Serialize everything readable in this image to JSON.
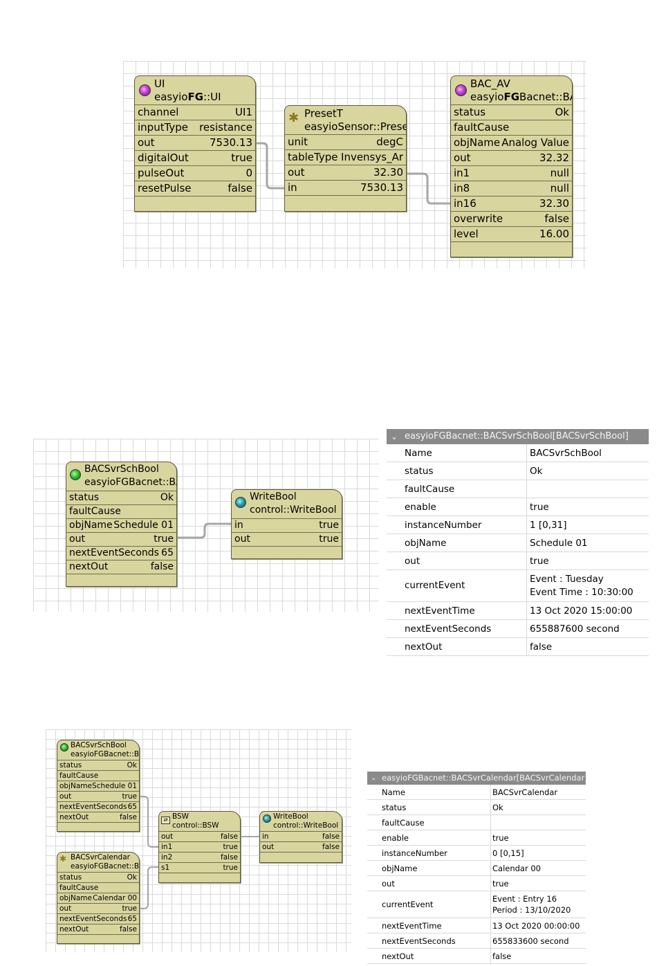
{
  "diagram1": {
    "ui": {
      "title": "UI",
      "type_prefix": "easyio",
      "type_bold": "FG",
      "type_suffix": "::UI",
      "rows": [
        {
          "k": "channel",
          "v": "UI1"
        },
        {
          "k": "inputType",
          "v": "resistance"
        },
        {
          "k": "out",
          "v": "7530.13"
        },
        {
          "k": "digitalOut",
          "v": "true"
        },
        {
          "k": "pulseOut",
          "v": "0"
        },
        {
          "k": "resetPulse",
          "v": "false"
        }
      ]
    },
    "preset": {
      "title": "PresetT",
      "type": "easyioSensor::Prese",
      "rows": [
        {
          "k": "unit",
          "v": "degC"
        },
        {
          "k": "tableType",
          "v": "Invensys_Ar"
        },
        {
          "k": "out",
          "v": "32.30"
        },
        {
          "k": "in",
          "v": "7530.13"
        }
      ]
    },
    "bacav": {
      "title": "BAC_AV",
      "type_prefix": "easyio",
      "type_bold": "FG",
      "type_suffix": "Bacnet::BA",
      "rows": [
        {
          "k": "status",
          "v": "Ok"
        },
        {
          "k": "faultCause",
          "v": ""
        },
        {
          "k": "objName",
          "v": "Analog Value"
        },
        {
          "k": "out",
          "v": "32.32"
        },
        {
          "k": "in1",
          "v": "null"
        },
        {
          "k": "in8",
          "v": "null"
        },
        {
          "k": "in16",
          "v": "32.30"
        },
        {
          "k": "overwrite",
          "v": "false"
        },
        {
          "k": "level",
          "v": "16.00"
        }
      ]
    }
  },
  "diagram2": {
    "sch": {
      "title": "BACSvrSchBool",
      "type": "easyioFGBacnet::BA",
      "rows": [
        {
          "k": "status",
          "v": "Ok"
        },
        {
          "k": "faultCause",
          "v": ""
        },
        {
          "k": "objName",
          "v": "Schedule 01"
        },
        {
          "k": "out",
          "v": "true"
        },
        {
          "k": "nextEventSeconds",
          "v": "65"
        },
        {
          "k": "nextOut",
          "v": "false"
        }
      ]
    },
    "wb": {
      "title": "WriteBool",
      "type": "control::WriteBool",
      "rows": [
        {
          "k": "in",
          "v": "true"
        },
        {
          "k": "out",
          "v": "true"
        }
      ]
    }
  },
  "sheet1": {
    "header": "easyioFGBacnet::BACSvrSchBool[BACSvrSchBool]",
    "rows": [
      {
        "k": "Name",
        "v": "BACSvrSchBool"
      },
      {
        "k": "status",
        "v": "Ok"
      },
      {
        "k": "faultCause",
        "v": ""
      },
      {
        "k": "enable",
        "v": "true"
      },
      {
        "k": "instanceNumber",
        "v": "1 [0,31]"
      },
      {
        "k": "objName",
        "v": "Schedule 01"
      },
      {
        "k": "out",
        "v": "true"
      },
      {
        "k": "currentEvent",
        "v": "Event : Tuesday",
        "v2": "Event Time : 10:30:00"
      },
      {
        "k": "nextEventTime",
        "v": "13 Oct 2020 15:00:00"
      },
      {
        "k": "nextEventSeconds",
        "v": "655887600 second"
      },
      {
        "k": "nextOut",
        "v": "false"
      }
    ]
  },
  "diagram3": {
    "sch": {
      "title": "BACSvrSchBool",
      "type": "easyioFGBacnet::BA",
      "rows": [
        {
          "k": "status",
          "v": "Ok"
        },
        {
          "k": "faultCause",
          "v": ""
        },
        {
          "k": "objName",
          "v": "Schedule 01"
        },
        {
          "k": "out",
          "v": "true"
        },
        {
          "k": "nextEventSeconds",
          "v": "65"
        },
        {
          "k": "nextOut",
          "v": "false"
        }
      ]
    },
    "cal": {
      "title": "BACSvrCalendar",
      "type": "easyioFGBacnet::BA",
      "rows": [
        {
          "k": "status",
          "v": "Ok"
        },
        {
          "k": "faultCause",
          "v": ""
        },
        {
          "k": "objName",
          "v": "Calendar 00"
        },
        {
          "k": "out",
          "v": "true"
        },
        {
          "k": "nextEventSeconds",
          "v": "65"
        },
        {
          "k": "nextOut",
          "v": "false"
        }
      ]
    },
    "bsw": {
      "title": "BSW",
      "type": "control::BSW",
      "rows": [
        {
          "k": "out",
          "v": "false"
        },
        {
          "k": "in1",
          "v": "true"
        },
        {
          "k": "in2",
          "v": "false"
        },
        {
          "k": "s1",
          "v": "true"
        }
      ]
    },
    "wb": {
      "title": "WriteBool",
      "type": "control::WriteBool",
      "rows": [
        {
          "k": "in",
          "v": "false"
        },
        {
          "k": "out",
          "v": "false"
        }
      ]
    }
  },
  "sheet2": {
    "header": "easyioFGBacnet::BACSvrCalendar[BACSvrCalendar]",
    "rows": [
      {
        "k": "Name",
        "v": "BACSvrCalendar"
      },
      {
        "k": "status",
        "v": "Ok"
      },
      {
        "k": "faultCause",
        "v": ""
      },
      {
        "k": "enable",
        "v": "true"
      },
      {
        "k": "instanceNumber",
        "v": "0 [0,15]"
      },
      {
        "k": "objName",
        "v": "Calendar 00"
      },
      {
        "k": "out",
        "v": "true"
      },
      {
        "k": "currentEvent",
        "v": "Event : Entry 16",
        "v2": "Period : 13/10/2020"
      },
      {
        "k": "nextEventTime",
        "v": "13 Oct 2020 00:00:00"
      },
      {
        "k": "nextEventSeconds",
        "v": "655833600 second"
      },
      {
        "k": "nextOut",
        "v": "false"
      }
    ]
  },
  "icons": {
    "chevron": "chevron-down-icon",
    "status_purple": "status-bulb-purple-icon",
    "status_green": "status-bulb-green-icon",
    "status_teal": "status-bulb-teal-icon",
    "gear": "gear-icon",
    "bsw": "switch-icon"
  },
  "colors": {
    "node_fill": "#d9d59f",
    "wire": "#a6a6a6",
    "sheet_header": "#8a8a8a"
  }
}
